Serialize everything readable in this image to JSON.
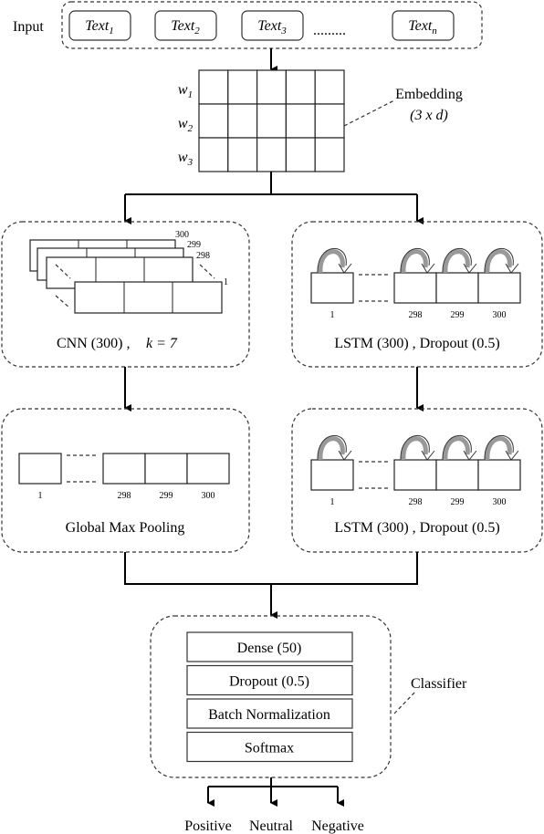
{
  "input": {
    "label": "Input",
    "texts": [
      {
        "base": "Text",
        "sub": "1"
      },
      {
        "base": "Text",
        "sub": "2"
      },
      {
        "base": "Text",
        "sub": "3"
      },
      {
        "base": "Text",
        "sub": "n"
      }
    ],
    "ellipsis": "........."
  },
  "embedding": {
    "rows": [
      {
        "base": "w",
        "sub": "1"
      },
      {
        "base": "w",
        "sub": "2"
      },
      {
        "base": "w",
        "sub": "3"
      }
    ],
    "label": "Embedding",
    "dims": "(3 x d)"
  },
  "cnn": {
    "label": "CNN (300) ,",
    "k": "k = 7",
    "filters": [
      "300",
      "299",
      "298",
      "1"
    ]
  },
  "lstm1": {
    "label": "LSTM (300) ,  Dropout (0.5)",
    "cells": [
      "1",
      "298",
      "299",
      "300"
    ]
  },
  "pooling": {
    "label": "Global Max Pooling",
    "cells": [
      "1",
      "298",
      "299",
      "300"
    ]
  },
  "lstm2": {
    "label": "LSTM (300) ,  Dropout (0.5)",
    "cells": [
      "1",
      "298",
      "299",
      "300"
    ]
  },
  "classifier": {
    "label": "Classifier",
    "layers": [
      "Dense (50)",
      "Dropout (0.5)",
      "Batch Normalization",
      "Softmax"
    ]
  },
  "outputs": [
    "Positive",
    "Neutral",
    "Negative"
  ]
}
